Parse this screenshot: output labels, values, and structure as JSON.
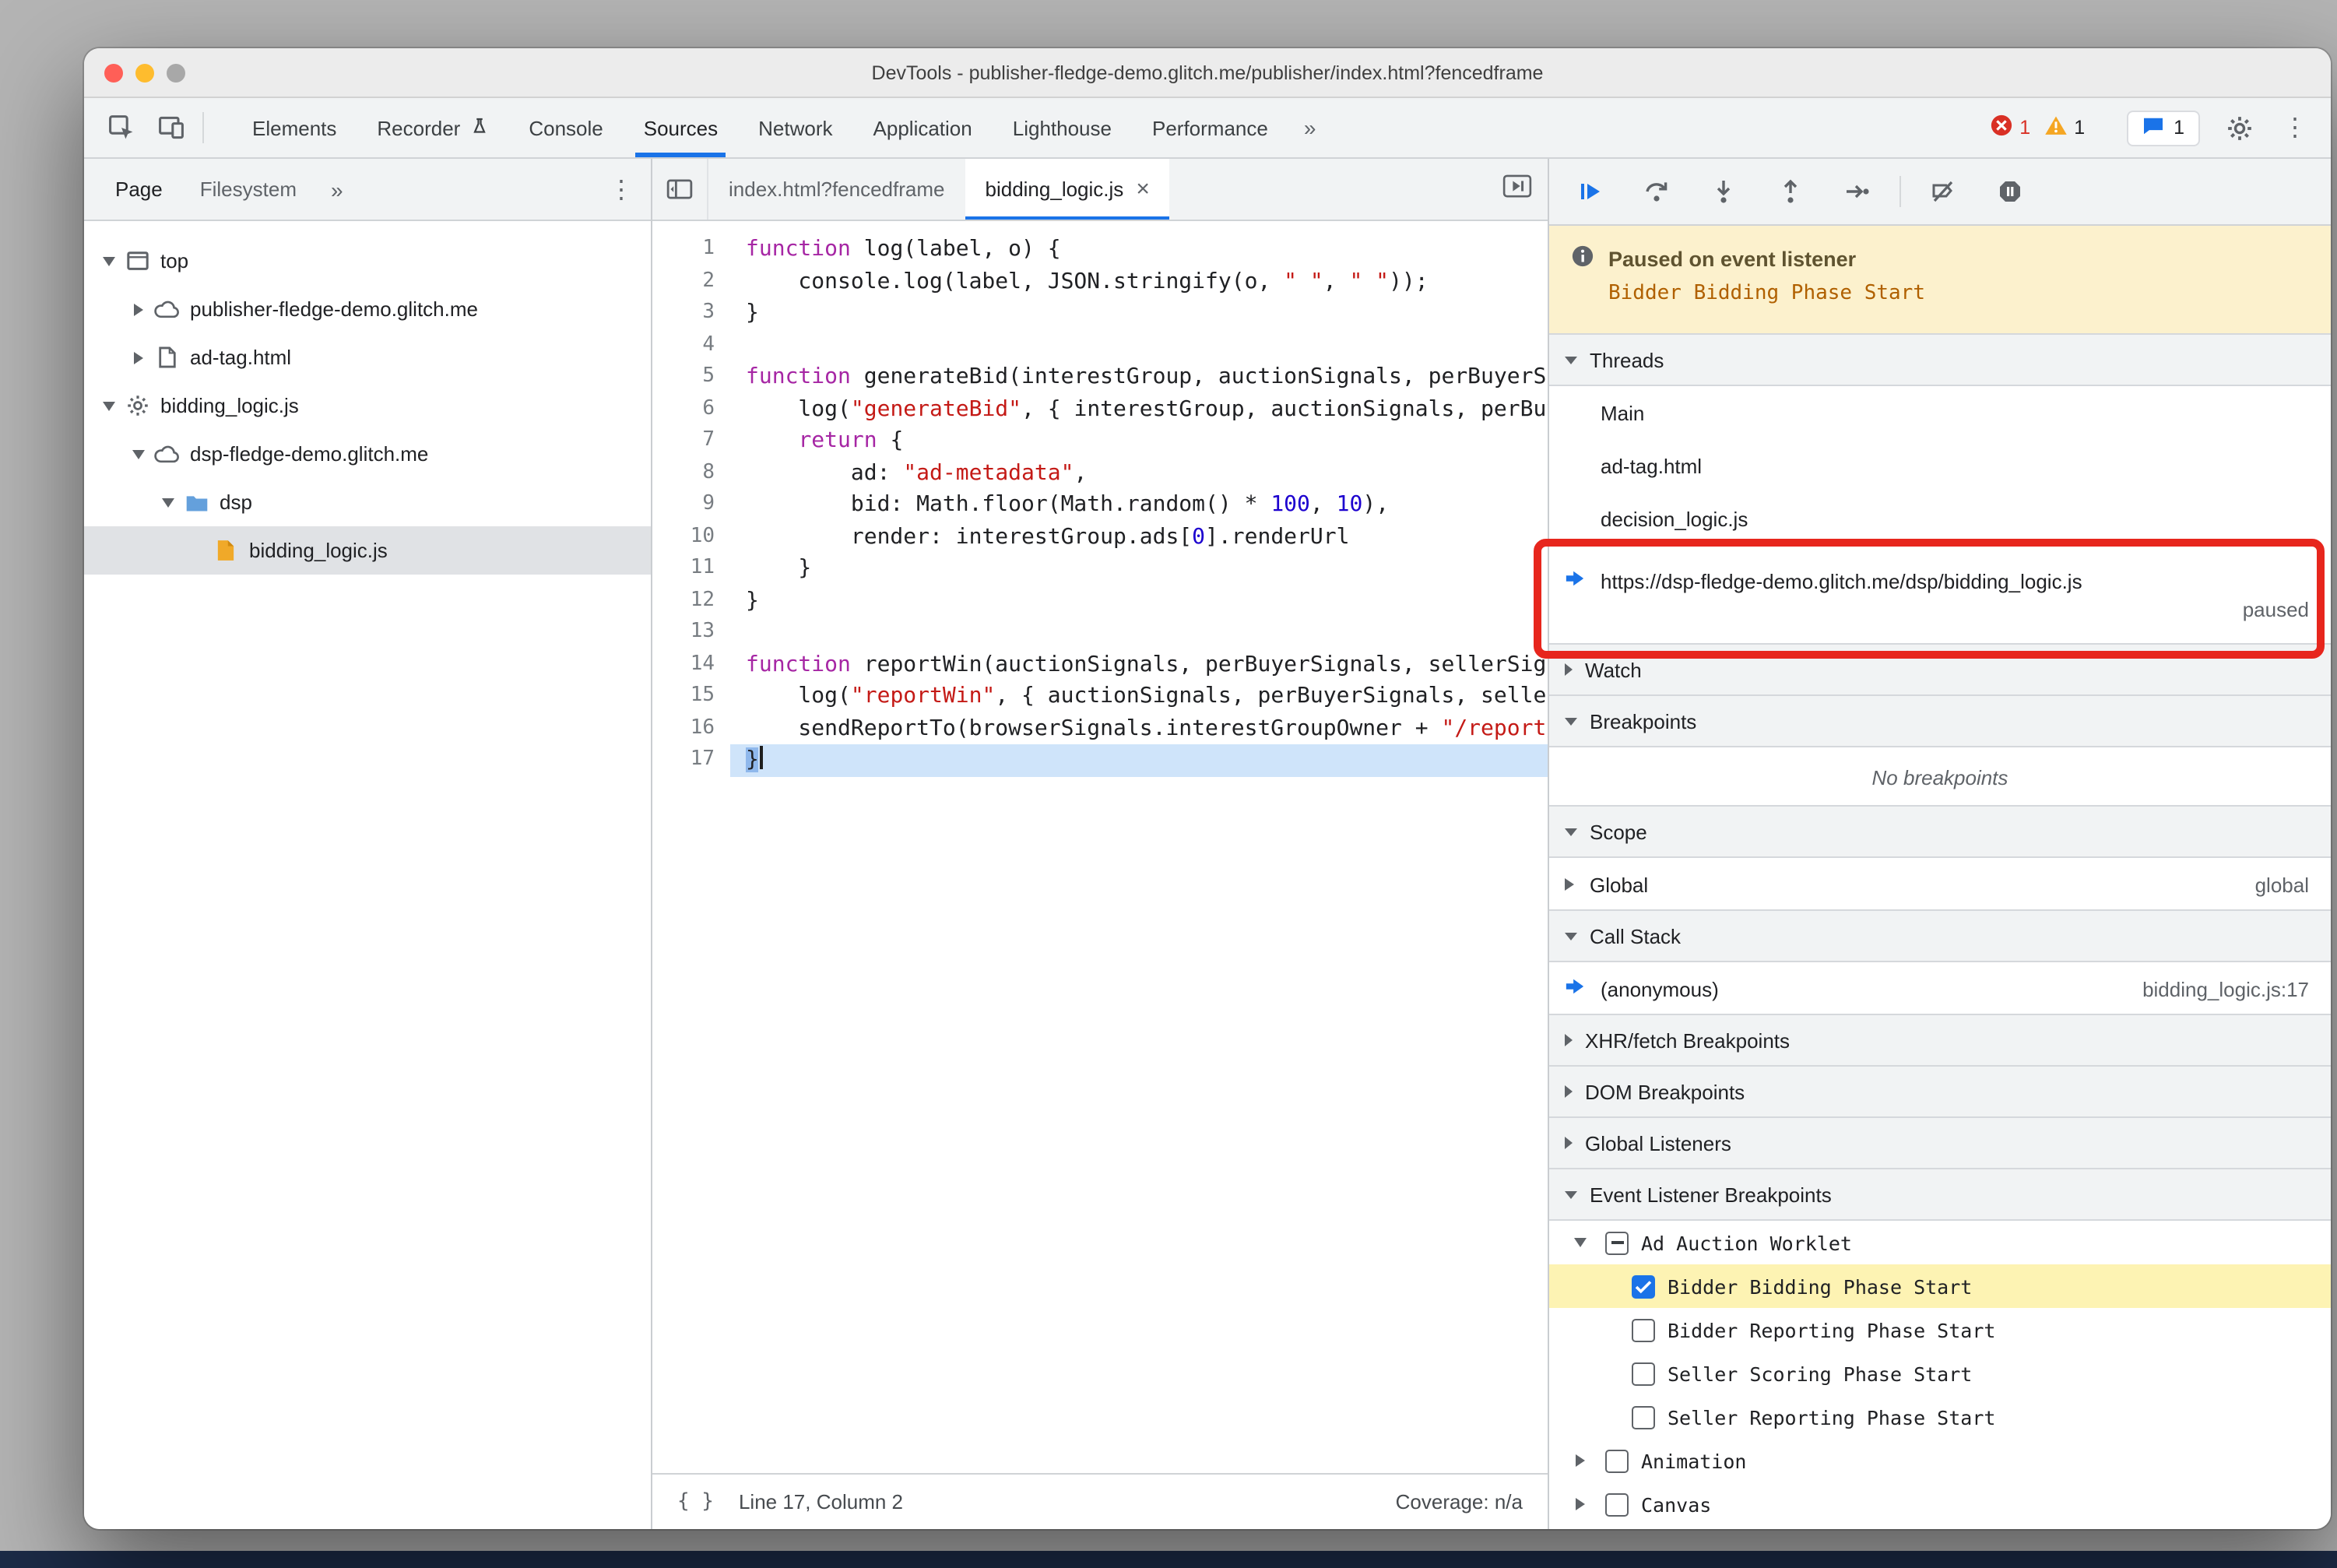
{
  "colors": {
    "accent": "#1a73e8",
    "annotation": "#e7261d",
    "banner_bg": "#fcf1cd",
    "hit_row": "#fdf3b3"
  },
  "window": {
    "title": "DevTools - publisher-fledge-demo.glitch.me/publisher/index.html?fencedframe"
  },
  "toolbar": {
    "tabs": [
      "Elements",
      "Recorder",
      "Console",
      "Sources",
      "Network",
      "Application",
      "Lighthouse",
      "Performance"
    ],
    "more": "»",
    "error_count": "1",
    "warning_count": "1",
    "issue_count": "1"
  },
  "sidebar": {
    "tabs": [
      "Page",
      "Filesystem"
    ],
    "more": "»",
    "tree": [
      {
        "label": "top"
      },
      {
        "label": "publisher-fledge-demo.glitch.me"
      },
      {
        "label": "ad-tag.html"
      },
      {
        "label": "bidding_logic.js"
      },
      {
        "label": "dsp-fledge-demo.glitch.me"
      },
      {
        "label": "dsp"
      },
      {
        "label": "bidding_logic.js"
      }
    ]
  },
  "editor": {
    "tabs": [
      {
        "label": "index.html?fencedframe"
      },
      {
        "label": "bidding_logic.js",
        "close": "×"
      }
    ],
    "current_line": 17,
    "lines": [
      [
        {
          "t": "function",
          "c": "kw"
        },
        {
          "t": " log(label, o) {",
          "c": "pl"
        }
      ],
      [
        {
          "t": "    console.log(label, JSON.stringify(o, ",
          "c": "pl"
        },
        {
          "t": "\" \"",
          "c": "str"
        },
        {
          "t": ", ",
          "c": "pl"
        },
        {
          "t": "\" \"",
          "c": "str"
        },
        {
          "t": "));",
          "c": "pl"
        }
      ],
      [
        {
          "t": "}",
          "c": "pl"
        }
      ],
      [],
      [
        {
          "t": "function",
          "c": "kw"
        },
        {
          "t": " generateBid(interestGroup, auctionSignals, perBuyerSignals, trustedBiddingSignals, browserSignals) {",
          "c": "pl"
        }
      ],
      [
        {
          "t": "    log(",
          "c": "pl"
        },
        {
          "t": "\"generateBid\"",
          "c": "str"
        },
        {
          "t": ", { interestGroup, auctionSignals, perBuyerSignals, trustedBiddingSignals });",
          "c": "pl"
        }
      ],
      [
        {
          "t": "    ",
          "c": "pl"
        },
        {
          "t": "return",
          "c": "kw"
        },
        {
          "t": " {",
          "c": "pl"
        }
      ],
      [
        {
          "t": "        ad: ",
          "c": "pl"
        },
        {
          "t": "\"ad-metadata\"",
          "c": "str"
        },
        {
          "t": ",",
          "c": "pl"
        }
      ],
      [
        {
          "t": "        bid: Math.floor(Math.random() * ",
          "c": "pl"
        },
        {
          "t": "100",
          "c": "num"
        },
        {
          "t": ", ",
          "c": "pl"
        },
        {
          "t": "10",
          "c": "num"
        },
        {
          "t": "),",
          "c": "pl"
        }
      ],
      [
        {
          "t": "        render: interestGroup.ads[",
          "c": "pl"
        },
        {
          "t": "0",
          "c": "num"
        },
        {
          "t": "].renderUrl",
          "c": "pl"
        }
      ],
      [
        {
          "t": "    }",
          "c": "pl"
        }
      ],
      [
        {
          "t": "}",
          "c": "pl"
        }
      ],
      [],
      [
        {
          "t": "function",
          "c": "kw"
        },
        {
          "t": " reportWin(auctionSignals, perBuyerSignals, sellerSignals, browserSignals) {",
          "c": "pl"
        }
      ],
      [
        {
          "t": "    log(",
          "c": "pl"
        },
        {
          "t": "\"reportWin\"",
          "c": "str"
        },
        {
          "t": ", { auctionSignals, perBuyerSignals, sellerSignals, browserSignals });",
          "c": "pl"
        }
      ],
      [
        {
          "t": "    sendReportTo(browserSignals.interestGroupOwner + ",
          "c": "pl"
        },
        {
          "t": "\"/report/bidder\"",
          "c": "str"
        },
        {
          "t": ");",
          "c": "pl"
        }
      ],
      [
        {
          "t": "}",
          "c": "pl",
          "exec": true
        }
      ]
    ],
    "status": {
      "pretty_print": "{ }",
      "line_col": "Line 17, Column 2",
      "coverage": "Coverage: n/a"
    }
  },
  "debugger": {
    "paused_title": "Paused on event listener",
    "paused_reason": "Bidder Bidding Phase Start",
    "threads": {
      "title": "Threads",
      "items": [
        {
          "label": "Main"
        },
        {
          "label": "ad-tag.html"
        },
        {
          "label": "decision_logic.js"
        },
        {
          "label": "https://dsp-fledge-demo.glitch.me/dsp/bidding_logic.js",
          "status": "paused"
        }
      ]
    },
    "watch": {
      "title": "Watch"
    },
    "breakpoints": {
      "title": "Breakpoints",
      "empty": "No breakpoints"
    },
    "scope": {
      "title": "Scope",
      "global_label": "Global",
      "global_value": "global"
    },
    "call_stack": {
      "title": "Call Stack",
      "frame": "(anonymous)",
      "location": "bidding_logic.js:17"
    },
    "xhr": {
      "title": "XHR/fetch Breakpoints"
    },
    "dom": {
      "title": "DOM Breakpoints"
    },
    "global_listeners": {
      "title": "Global Listeners"
    },
    "elb": {
      "title": "Event Listener Breakpoints",
      "group": "Ad Auction Worklet",
      "children": [
        "Bidder Bidding Phase Start",
        "Bidder Reporting Phase Start",
        "Seller Scoring Phase Start",
        "Seller Reporting Phase Start"
      ],
      "others": [
        "Animation",
        "Canvas"
      ]
    }
  }
}
